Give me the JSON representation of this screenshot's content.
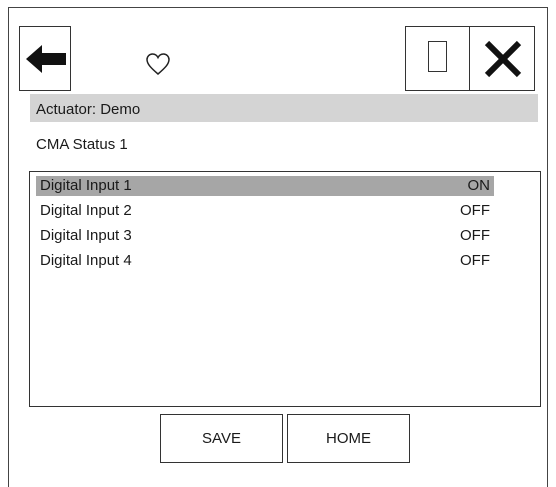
{
  "header": {
    "back_icon": "arrow-left-icon",
    "favorite_icon": "heart-outline-icon",
    "window_icon": "rectangle-outline-icon",
    "close_icon": "close-x-icon"
  },
  "actuator_label": "Actuator: Demo",
  "status_title": "CMA Status 1",
  "inputs": [
    {
      "label": "Digital Input 1",
      "value": "ON",
      "selected": true
    },
    {
      "label": "Digital Input 2",
      "value": "OFF",
      "selected": false
    },
    {
      "label": "Digital Input 3",
      "value": "OFF",
      "selected": false
    },
    {
      "label": "Digital Input 4",
      "value": "OFF",
      "selected": false
    }
  ],
  "footer": {
    "save_label": "SAVE",
    "home_label": "HOME"
  },
  "colors": {
    "header_bar": "#d4d4d4",
    "selected_row": "#a6a6a6",
    "border": "#333333"
  }
}
